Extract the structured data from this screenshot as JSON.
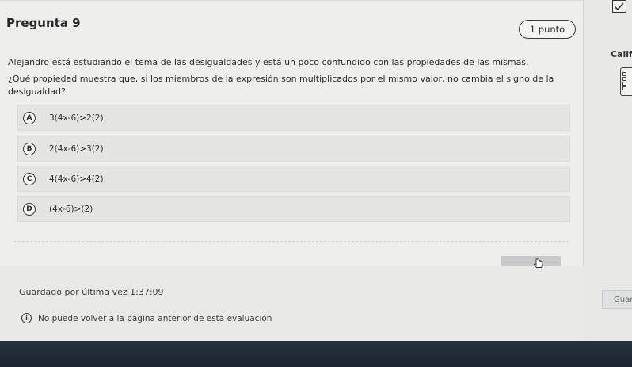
{
  "question": {
    "title": "Pregunta 9",
    "points": "1 punto",
    "stem_line1": "Alejandro está estudiando el tema de las desigualdades y está un poco confundido con las propiedades de las mismas.",
    "stem_line2": "¿Qué propiedad muestra que, si los miembros de la expresión son multiplicados por el mismo valor, no cambia el signo de la desigualdad?",
    "options": [
      {
        "letter": "A",
        "text": "3(4x-6)>2(2)"
      },
      {
        "letter": "B",
        "text": "2(4x-6)>3(2)"
      },
      {
        "letter": "C",
        "text": "4(4x-6)>4(2)"
      },
      {
        "letter": "D",
        "text": "(4x-6)>(2)"
      }
    ]
  },
  "footer": {
    "saved": "Guardado por última vez 1:37:09",
    "notice": "No puede volver a la página anterior de esta evaluación",
    "info_icon": "i"
  },
  "sidebar": {
    "grade_label": "Calif",
    "save_button": "Guar"
  },
  "icons": {
    "check": "checkbox-icon",
    "calculator": "calculator-icon",
    "cursor": "hand-cursor-icon"
  }
}
